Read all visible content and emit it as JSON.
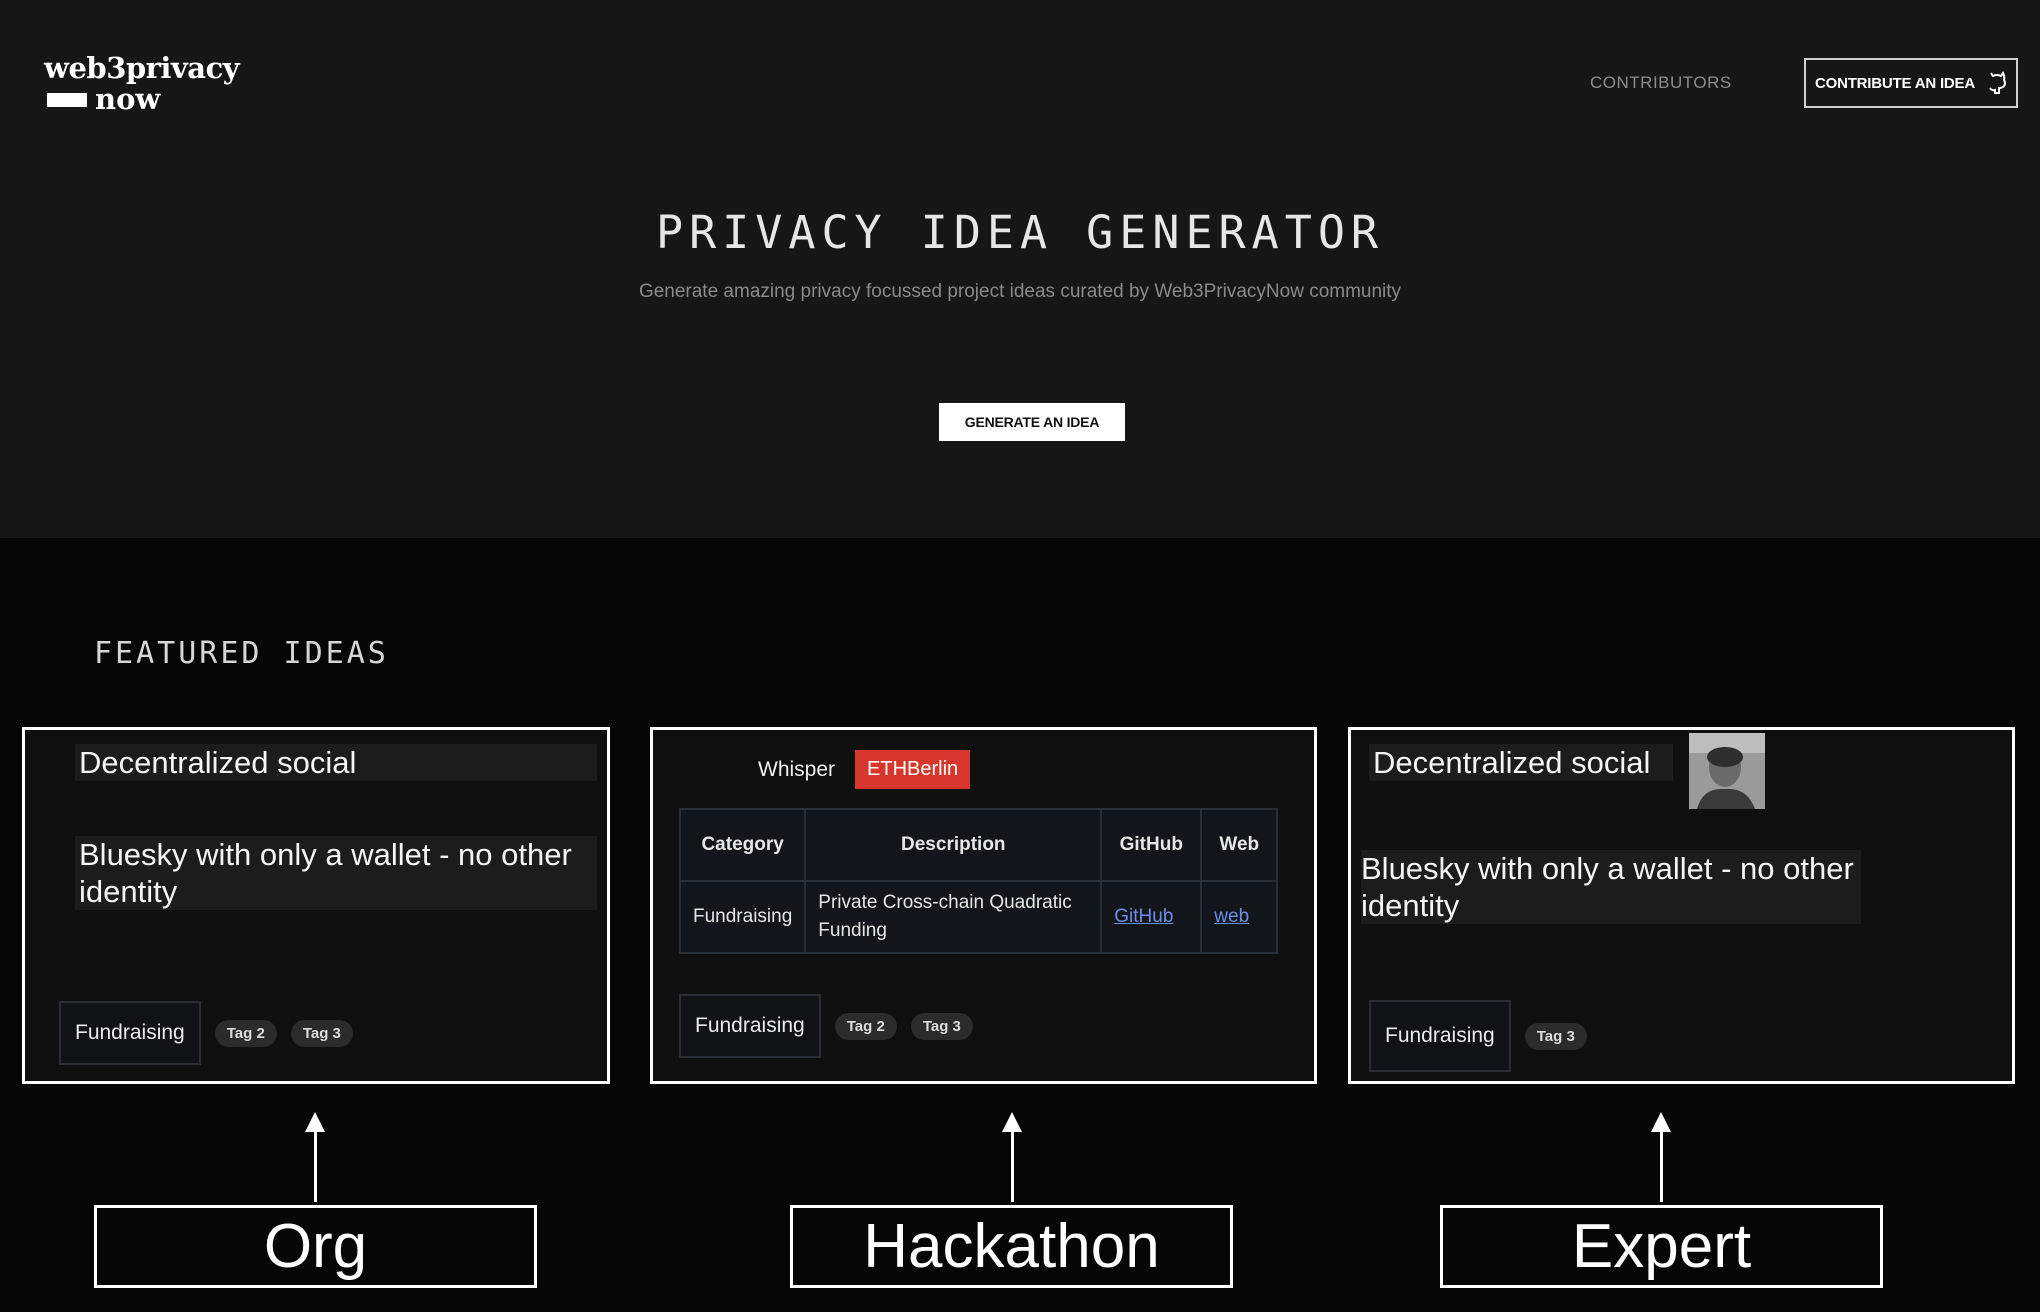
{
  "header": {
    "logo_line1": "web3privacy",
    "logo_line2": "now",
    "nav_contributors": "CONTRIBUTORS",
    "contribute_label": "CONTRIBUTE AN IDEA",
    "contribute_icon": "github-icon"
  },
  "hero": {
    "title": "PRIVACY IDEA GENERATOR",
    "subtitle": "Generate amazing privacy focussed project ideas curated by Web3PrivacyNow community",
    "generate_label": "GENERATE AN IDEA"
  },
  "featured": {
    "title": "FEATURED IDEAS",
    "cards": [
      {
        "heading": "Decentralized social",
        "body": "Bluesky with only a wallet  - no other identity",
        "main_tag": "Fundraising",
        "tags": [
          "Tag 2",
          "Tag 3"
        ]
      },
      {
        "topic": "Whisper",
        "badge": "ETHBerlin",
        "badge_color": "#d6362c",
        "table": {
          "headers": [
            "Category",
            "Description",
            "GitHub",
            "Web"
          ],
          "row": {
            "category": "Fundraising",
            "description": "Private Cross-chain Quadratic Funding",
            "github": "GitHub",
            "web": "web"
          }
        },
        "main_tag": "Fundraising",
        "tags": [
          "Tag 2",
          "Tag 3"
        ]
      },
      {
        "heading": "Decentralized social",
        "body": "Bluesky with only a wallet  - no other identity",
        "main_tag": "Fundraising",
        "tags": [
          "Tag 3"
        ]
      }
    ]
  },
  "annotations": [
    "Org",
    "Hackathon",
    "Expert"
  ]
}
